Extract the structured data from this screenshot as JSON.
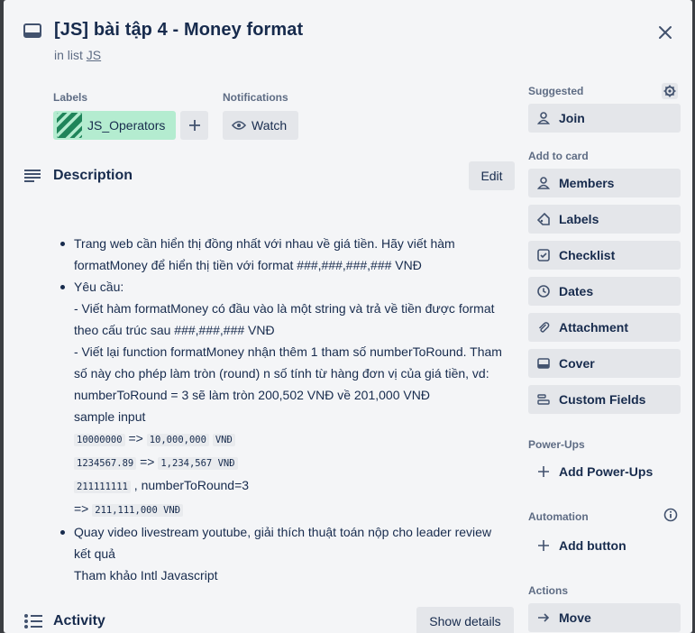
{
  "header": {
    "title": "[JS] bài tập 4 - Money format",
    "in_list_prefix": "in list ",
    "list_name": "JS"
  },
  "labels_section": {
    "heading": "Labels",
    "label": "JS_Operators",
    "label_color": "#b4ecd0"
  },
  "notifications": {
    "heading": "Notifications",
    "watch_label": "Watch"
  },
  "description": {
    "heading": "Description",
    "edit_label": "Edit",
    "bullet1_line1": "Trang web cần hiển thị đồng nhất với nhau về giá tiền. Hãy viết hàm",
    "bullet1_line2": "formatMoney để hiển thị tiền với format ###,###,###,### VNĐ",
    "bullet2_line1": "Yêu cầu:",
    "bullet2_line2": "- Viết hàm formatMoney có đầu vào là một string và trả về tiền được format",
    "bullet2_line3": "theo cấu trúc sau ###,###,### VNĐ",
    "bullet2_line4": "- Viết lại function formatMoney nhận thêm 1 tham số numberToRound. Tham",
    "bullet2_line5": "số này cho phép làm tròn (round) n số tính từ hàng đơn vị của giá tiền, vd:",
    "bullet2_line6": "numberToRound = 3 sẽ làm tròn 200,502 VNĐ về 201,000 VNĐ",
    "bullet2_line7": "sample input",
    "ex1_in": "10000000",
    "ex1_arrow": " => ",
    "ex1_out": "10,000,000",
    "ex1_unit": "VNĐ",
    "ex2_in": "1234567.89",
    "ex2_arrow": " => ",
    "ex2_out": "1,234,567 VNĐ",
    "ex3_in": "211111111",
    "ex3_rest": " , numberToRound=3",
    "ex4_arrow": "=> ",
    "ex4_out": "211,111,000 VNĐ",
    "bullet3_line1": "Quay video livestream youtube, giải thích thuật toán nộp cho leader review",
    "bullet3_line2": "kết quả",
    "bullet3_line3": "Tham khảo Intl Javascript"
  },
  "activity": {
    "heading": "Activity",
    "show_details_label": "Show details"
  },
  "sidebar": {
    "suggested_heading": "Suggested",
    "join_label": "Join",
    "add_to_card_heading": "Add to card",
    "members_label": "Members",
    "labels_label": "Labels",
    "checklist_label": "Checklist",
    "dates_label": "Dates",
    "attachment_label": "Attachment",
    "cover_label": "Cover",
    "custom_fields_label": "Custom Fields",
    "powerups_heading": "Power-Ups",
    "add_powerups_label": "Add Power-Ups",
    "automation_heading": "Automation",
    "add_button_label": "Add button",
    "actions_heading": "Actions",
    "move_label": "Move"
  }
}
